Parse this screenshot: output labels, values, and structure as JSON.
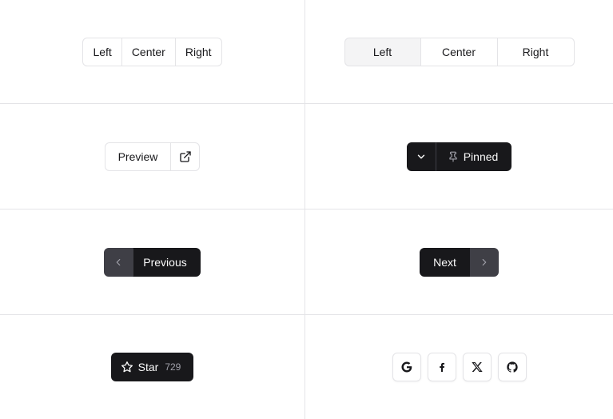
{
  "segmented_small": {
    "left": "Left",
    "center": "Center",
    "right": "Right"
  },
  "segmented_large": {
    "left": "Left",
    "center": "Center",
    "right": "Right",
    "selected": "Left"
  },
  "preview_button": {
    "label": "Preview",
    "icon": "external-link-icon"
  },
  "pinned_button": {
    "label": "Pinned",
    "dropdown_icon": "chevron-down-icon",
    "icon": "pin-icon"
  },
  "previous_button": {
    "label": "Previous",
    "icon": "chevron-left-icon"
  },
  "next_button": {
    "label": "Next",
    "icon": "chevron-right-icon"
  },
  "star_button": {
    "label": "Star",
    "count": "729",
    "icon": "star-icon"
  },
  "social_buttons": [
    {
      "icon": "google-icon"
    },
    {
      "icon": "facebook-icon"
    },
    {
      "icon": "x-icon"
    },
    {
      "icon": "github-icon"
    }
  ],
  "colors": {
    "dark": "#18181b",
    "border": "#e4e4e7",
    "muted": "#f4f4f5",
    "grey": "#3f3f46"
  }
}
